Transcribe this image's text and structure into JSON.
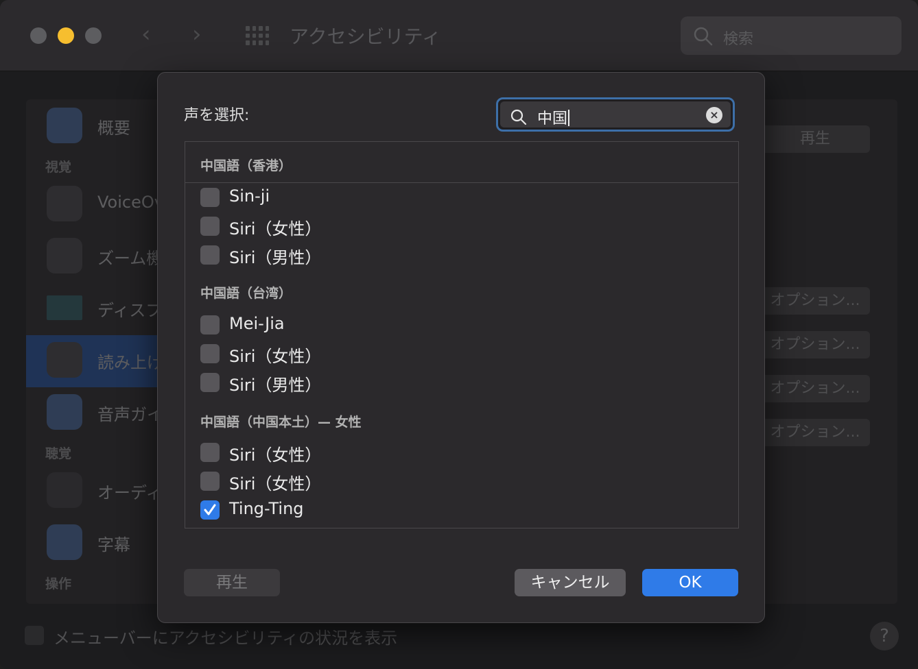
{
  "window": {
    "title": "アクセシビリティ",
    "search_placeholder": "検索"
  },
  "sidebar": {
    "sections": [
      "視覚",
      "聴覚",
      "操作"
    ],
    "items": [
      {
        "label": "概要"
      },
      {
        "label": "VoiceOver"
      },
      {
        "label": "ズーム機能"
      },
      {
        "label": "ディスプレイ"
      },
      {
        "label": "読み上げコンテンツ"
      },
      {
        "label": "音声ガイド"
      },
      {
        "label": "オーディオ"
      },
      {
        "label": "字幕"
      }
    ]
  },
  "background": {
    "play_button": "再生",
    "options_button": "オプション...",
    "menubar_checkbox": "メニューバーにアクセシビリティの状況を表示",
    "help": "?"
  },
  "dialog": {
    "title": "声を選択:",
    "search_query": "中国",
    "groups": [
      {
        "label": "中国語（香港）",
        "voices": [
          {
            "name": "Sin-ji",
            "checked": false
          },
          {
            "name": "Siri（女性）",
            "checked": false
          },
          {
            "name": "Siri（男性）",
            "checked": false
          }
        ]
      },
      {
        "label": "中国語（台湾）",
        "voices": [
          {
            "name": "Mei-Jia",
            "checked": false
          },
          {
            "name": "Siri（女性）",
            "checked": false
          },
          {
            "name": "Siri（男性）",
            "checked": false
          }
        ]
      },
      {
        "label": "中国語（中国本土）— 女性",
        "voices": [
          {
            "name": "Siri（女性）",
            "checked": false
          },
          {
            "name": "Siri（女性）",
            "checked": false
          },
          {
            "name": "Ting-Ting",
            "checked": true
          }
        ]
      }
    ],
    "buttons": {
      "play": "再生",
      "cancel": "キャンセル",
      "ok": "OK"
    }
  },
  "colors": {
    "accent": "#2f7be8",
    "focus_ring": "#3d6fa8"
  }
}
